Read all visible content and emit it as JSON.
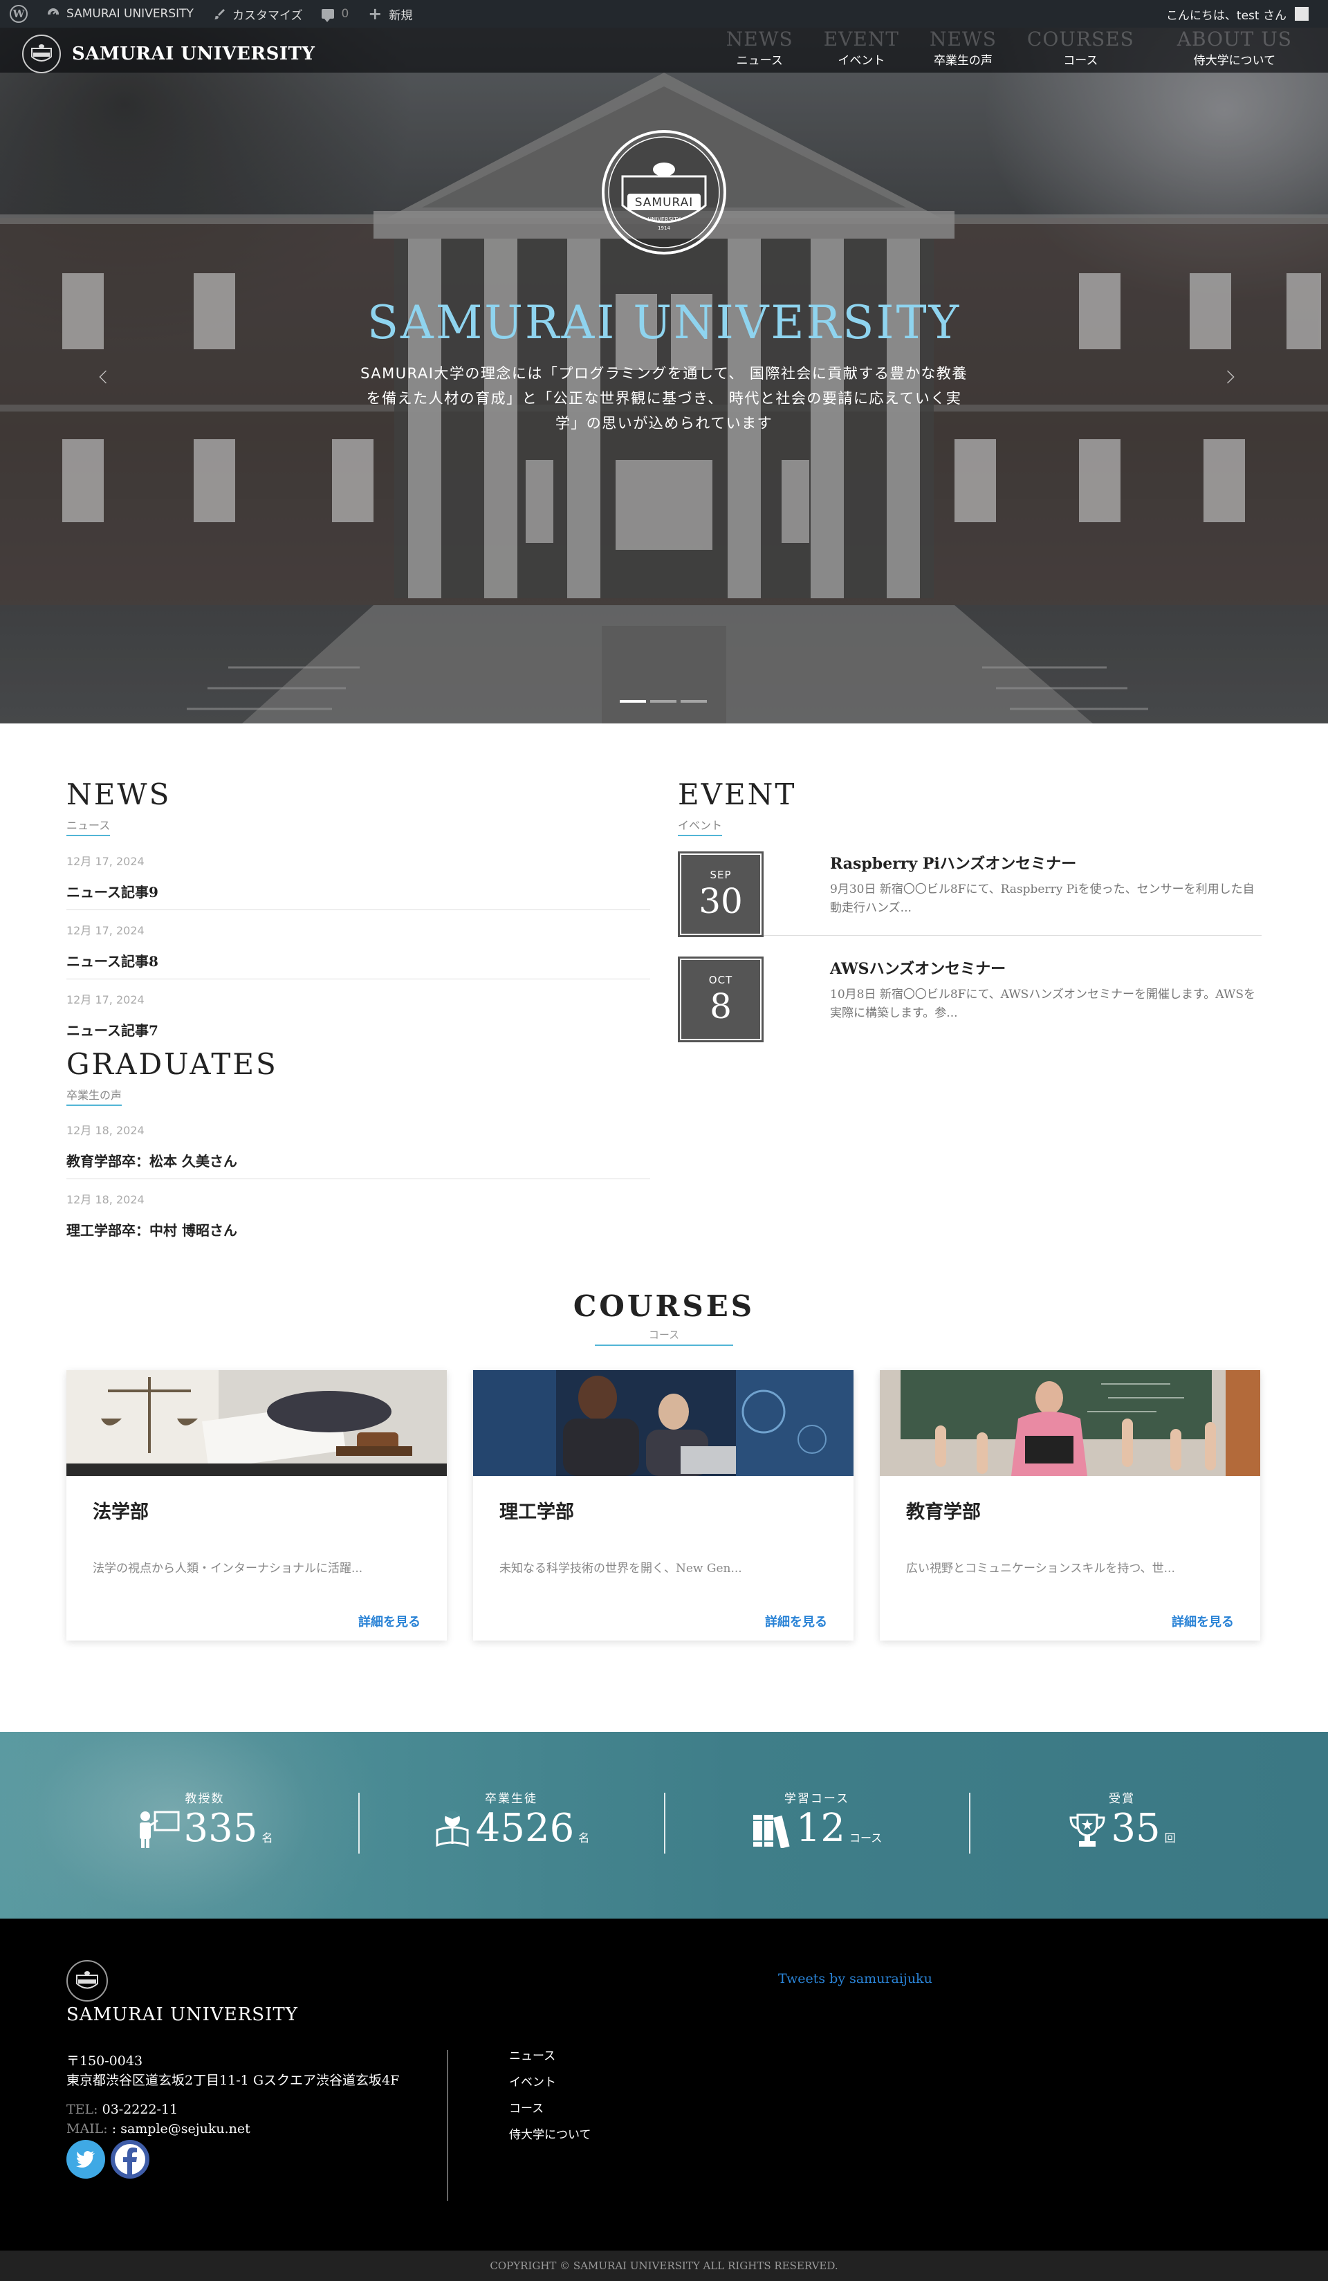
{
  "adminbar": {
    "site": "SAMURAI UNIVERSITY",
    "customize": "カスタマイズ",
    "comments": "0",
    "new": "新規",
    "greeting": "こんにちは、test さん"
  },
  "nav": {
    "brand": "SAMURAI UNIVERSITY",
    "items": [
      {
        "en": "NEWS",
        "ja": "ニュース"
      },
      {
        "en": "EVENT",
        "ja": "イベント"
      },
      {
        "en": "NEWS",
        "ja": "卒業生の声"
      },
      {
        "en": "COURSES",
        "ja": "コース"
      },
      {
        "en": "ABOUT US",
        "ja": "侍大学について"
      }
    ]
  },
  "hero": {
    "emblem_text": "SAMURAI",
    "emblem_sub": "UNIVERSITY",
    "emblem_year": "1914",
    "title": "SAMURAI UNIVERSITY",
    "text": "SAMURAI大学の理念には「プログラミングを通して、 国際社会に貢献する豊かな教養を備えた人材の育成」と「公正な世界観に基づき、 時代と社会の要請に応えていく実学」の思いが込められています",
    "active_slide": 1,
    "slide_count": 3
  },
  "news": {
    "title_en": "NEWS",
    "title_ja": "ニュース",
    "items": [
      {
        "date": "12月 17, 2024",
        "title": "ニュース記事9"
      },
      {
        "date": "12月 17, 2024",
        "title": "ニュース記事8"
      },
      {
        "date": "12月 17, 2024",
        "title": "ニュース記事7"
      }
    ]
  },
  "graduates": {
    "title_en": "GRADUATES",
    "title_ja": "卒業生の声",
    "items": [
      {
        "date": "12月 18, 2024",
        "title": "教育学部卒：松本 久美さん"
      },
      {
        "date": "12月 18, 2024",
        "title": "理工学部卒：中村 博昭さん"
      }
    ]
  },
  "event": {
    "title_en": "EVENT",
    "title_ja": "イベント",
    "items": [
      {
        "month": "SEP",
        "day": "30",
        "title": "Raspberry Piハンズオンセミナー",
        "desc": "9月30日 新宿〇〇ビル8Fにて、Raspberry Piを使った、センサーを利用した自動走行ハンズ..."
      },
      {
        "month": "OCT",
        "day": "8",
        "title": "AWSハンズオンセミナー",
        "desc": "10月8日 新宿〇〇ビル8Fにて、AWSハンズオンセミナーを開催します。AWSを実際に構築します。参..."
      }
    ]
  },
  "courses": {
    "title_en": "COURSES",
    "title_ja": "コース",
    "link_label": "詳細を見る",
    "items": [
      {
        "title": "法学部",
        "desc": "法学の視点から人類・インターナショナルに活躍..."
      },
      {
        "title": "理工学部",
        "desc": "未知なる科学技術の世界を開く、New Gen..."
      },
      {
        "title": "教育学部",
        "desc": "広い視野とコミュニケーションスキルを持つ、世..."
      }
    ]
  },
  "stats": [
    {
      "label": "教授数",
      "value": "335",
      "unit": "名",
      "icon": "teacher-icon"
    },
    {
      "label": "卒業生徒",
      "value": "4526",
      "unit": "名",
      "icon": "graduate-icon"
    },
    {
      "label": "学習コース",
      "value": "12",
      "unit": "コース",
      "icon": "books-icon"
    },
    {
      "label": "受賞",
      "value": "35",
      "unit": "回",
      "icon": "trophy-icon"
    }
  ],
  "footer": {
    "brand": "SAMURAI UNIVERSITY",
    "postal": "〒150-0043",
    "address": "東京都渋谷区道玄坂2丁目11-1 Gスクエア渋谷道玄坂4F",
    "tel_label": "TEL:",
    "tel": "03-2222-11",
    "mail_label": "MAIL:",
    "mail": ": sample@sejuku.net",
    "links": [
      "ニュース",
      "イベント",
      "コース",
      "侍大学について"
    ],
    "tweets": "Tweets by samuraijuku",
    "copyright": "COPYRIGHT © SAMURAI UNIVERSITY ALL RIGHTS RESERVED."
  },
  "colors": {
    "accent": "#52b5d6",
    "hero_title": "#8fd4ef",
    "link": "#2a83d6",
    "stats_bg": "#4b8c95",
    "adminbar": "#23282d"
  }
}
